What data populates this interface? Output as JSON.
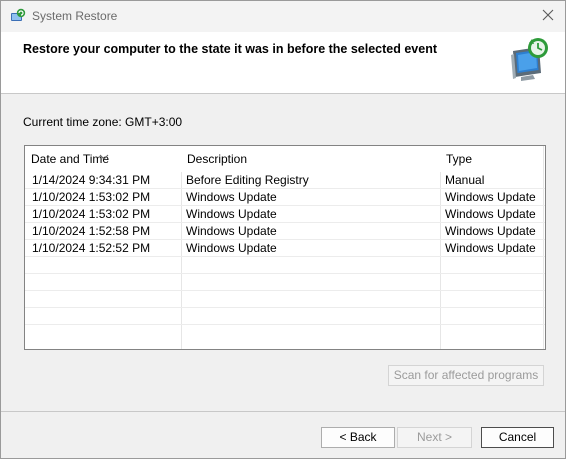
{
  "window": {
    "title": "System Restore",
    "icons": {
      "app": "system-restore-icon",
      "close": "close-icon",
      "header": "monitor-restore-icon"
    }
  },
  "header": {
    "title": "Restore your computer to the state it was in before the selected event"
  },
  "timezone": {
    "text": "Current time zone: GMT+3:00"
  },
  "table": {
    "columns": [
      "Date and Time",
      "Description",
      "Type"
    ],
    "sort": {
      "column": "Date and Time",
      "direction": "descending"
    },
    "rows": [
      {
        "date": "1/14/2024 9:34:31 PM",
        "description": "Before Editing Registry",
        "type": "Manual"
      },
      {
        "date": "1/10/2024 1:53:02 PM",
        "description": "Windows Update",
        "type": "Windows Update"
      },
      {
        "date": "1/10/2024 1:53:02 PM",
        "description": "Windows Update",
        "type": "Windows Update"
      },
      {
        "date": "1/10/2024 1:52:58 PM",
        "description": "Windows Update",
        "type": "Windows Update"
      },
      {
        "date": "1/10/2024 1:52:52 PM",
        "description": "Windows Update",
        "type": "Windows Update"
      }
    ]
  },
  "buttons": {
    "scan": "Scan for affected programs",
    "back": "< Back",
    "next": "Next >",
    "cancel": "Cancel"
  }
}
